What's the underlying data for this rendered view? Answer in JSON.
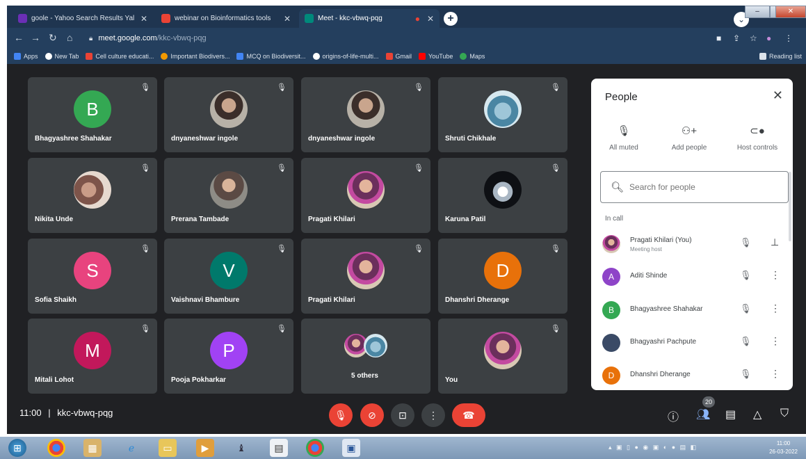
{
  "browser": {
    "tabs": [
      {
        "title": "goole - Yahoo Search Results Yal",
        "color": "#6b2fb5"
      },
      {
        "title": "webinar on Bioinformatics tools",
        "color": "#ea4335"
      },
      {
        "title": "Meet - kkc-vbwq-pqg",
        "color": "#00897b"
      }
    ],
    "url_host": "meet.google.com",
    "url_path": "/kkc-vbwq-pqg",
    "bookmarks": [
      {
        "label": "Apps",
        "color": "#4285f4"
      },
      {
        "label": "New Tab",
        "color": "#ffffff"
      },
      {
        "label": "Cell culture educati...",
        "color": "#ea4335"
      },
      {
        "label": "Important Biodivers...",
        "color": "#f29900"
      },
      {
        "label": "MCQ on Biodiversit...",
        "color": "#4285f4"
      },
      {
        "label": "origins-of-life-multi...",
        "color": "#ffffff"
      },
      {
        "label": "Gmail",
        "color": "#ea4335"
      },
      {
        "label": "YouTube",
        "color": "#ff0000"
      },
      {
        "label": "Maps",
        "color": "#34a853"
      }
    ],
    "reading_list": "Reading list"
  },
  "tiles": [
    {
      "name": "Bhagyashree Shahakar",
      "initial": "B",
      "color": "#34a853"
    },
    {
      "name": "dnyaneshwar ingole",
      "initial": "",
      "color": ""
    },
    {
      "name": "dnyaneshwar ingole",
      "initial": "",
      "color": ""
    },
    {
      "name": "Shruti Chikhale",
      "initial": "",
      "color": ""
    },
    {
      "name": "Nikita Unde",
      "initial": "",
      "color": ""
    },
    {
      "name": "Prerana Tambade",
      "initial": "",
      "color": ""
    },
    {
      "name": "Pragati Khilari",
      "initial": "",
      "color": ""
    },
    {
      "name": "Karuna Patil",
      "initial": "",
      "color": ""
    },
    {
      "name": "Sofia Shaikh",
      "initial": "S",
      "color": "#e8437e"
    },
    {
      "name": "Vaishnavi Bhambure",
      "initial": "V",
      "color": "#00796b"
    },
    {
      "name": "Pragati Khilari",
      "initial": "",
      "color": ""
    },
    {
      "name": "Dhanshri Dherange",
      "initial": "D",
      "color": "#e8710a"
    },
    {
      "name": "Mitali Lohot",
      "initial": "M",
      "color": "#c2185b"
    },
    {
      "name": "Pooja Pokharkar",
      "initial": "P",
      "color": "#a142f4"
    },
    {
      "name": "5 others",
      "initial": "",
      "color": ""
    },
    {
      "name": "You",
      "initial": "",
      "color": ""
    }
  ],
  "people_panel": {
    "title": "People",
    "actions": [
      "All muted",
      "Add people",
      "Host controls"
    ],
    "search_placeholder": "Search for people",
    "section_label": "In call",
    "participants": [
      {
        "name": "Pragati Khilari (You)",
        "sub": "Meeting host",
        "initial": "",
        "color": "#c34aa0"
      },
      {
        "name": "Aditi Shinde",
        "sub": "",
        "initial": "A",
        "color": "#8e44c8"
      },
      {
        "name": "Bhagyashree Shahakar",
        "sub": "",
        "initial": "B",
        "color": "#34a853"
      },
      {
        "name": "Bhagyashri Pachpute",
        "sub": "",
        "initial": "",
        "color": "#3a4a66"
      },
      {
        "name": "Dhanshri Dherange",
        "sub": "",
        "initial": "D",
        "color": "#e8710a"
      }
    ]
  },
  "bottom_bar": {
    "time": "11:00",
    "separator": "|",
    "meeting_code": "kkc-vbwq-pqg",
    "participant_count": "20"
  },
  "taskbar": {
    "clock_time": "11:00",
    "clock_date": "26-03-2022"
  }
}
